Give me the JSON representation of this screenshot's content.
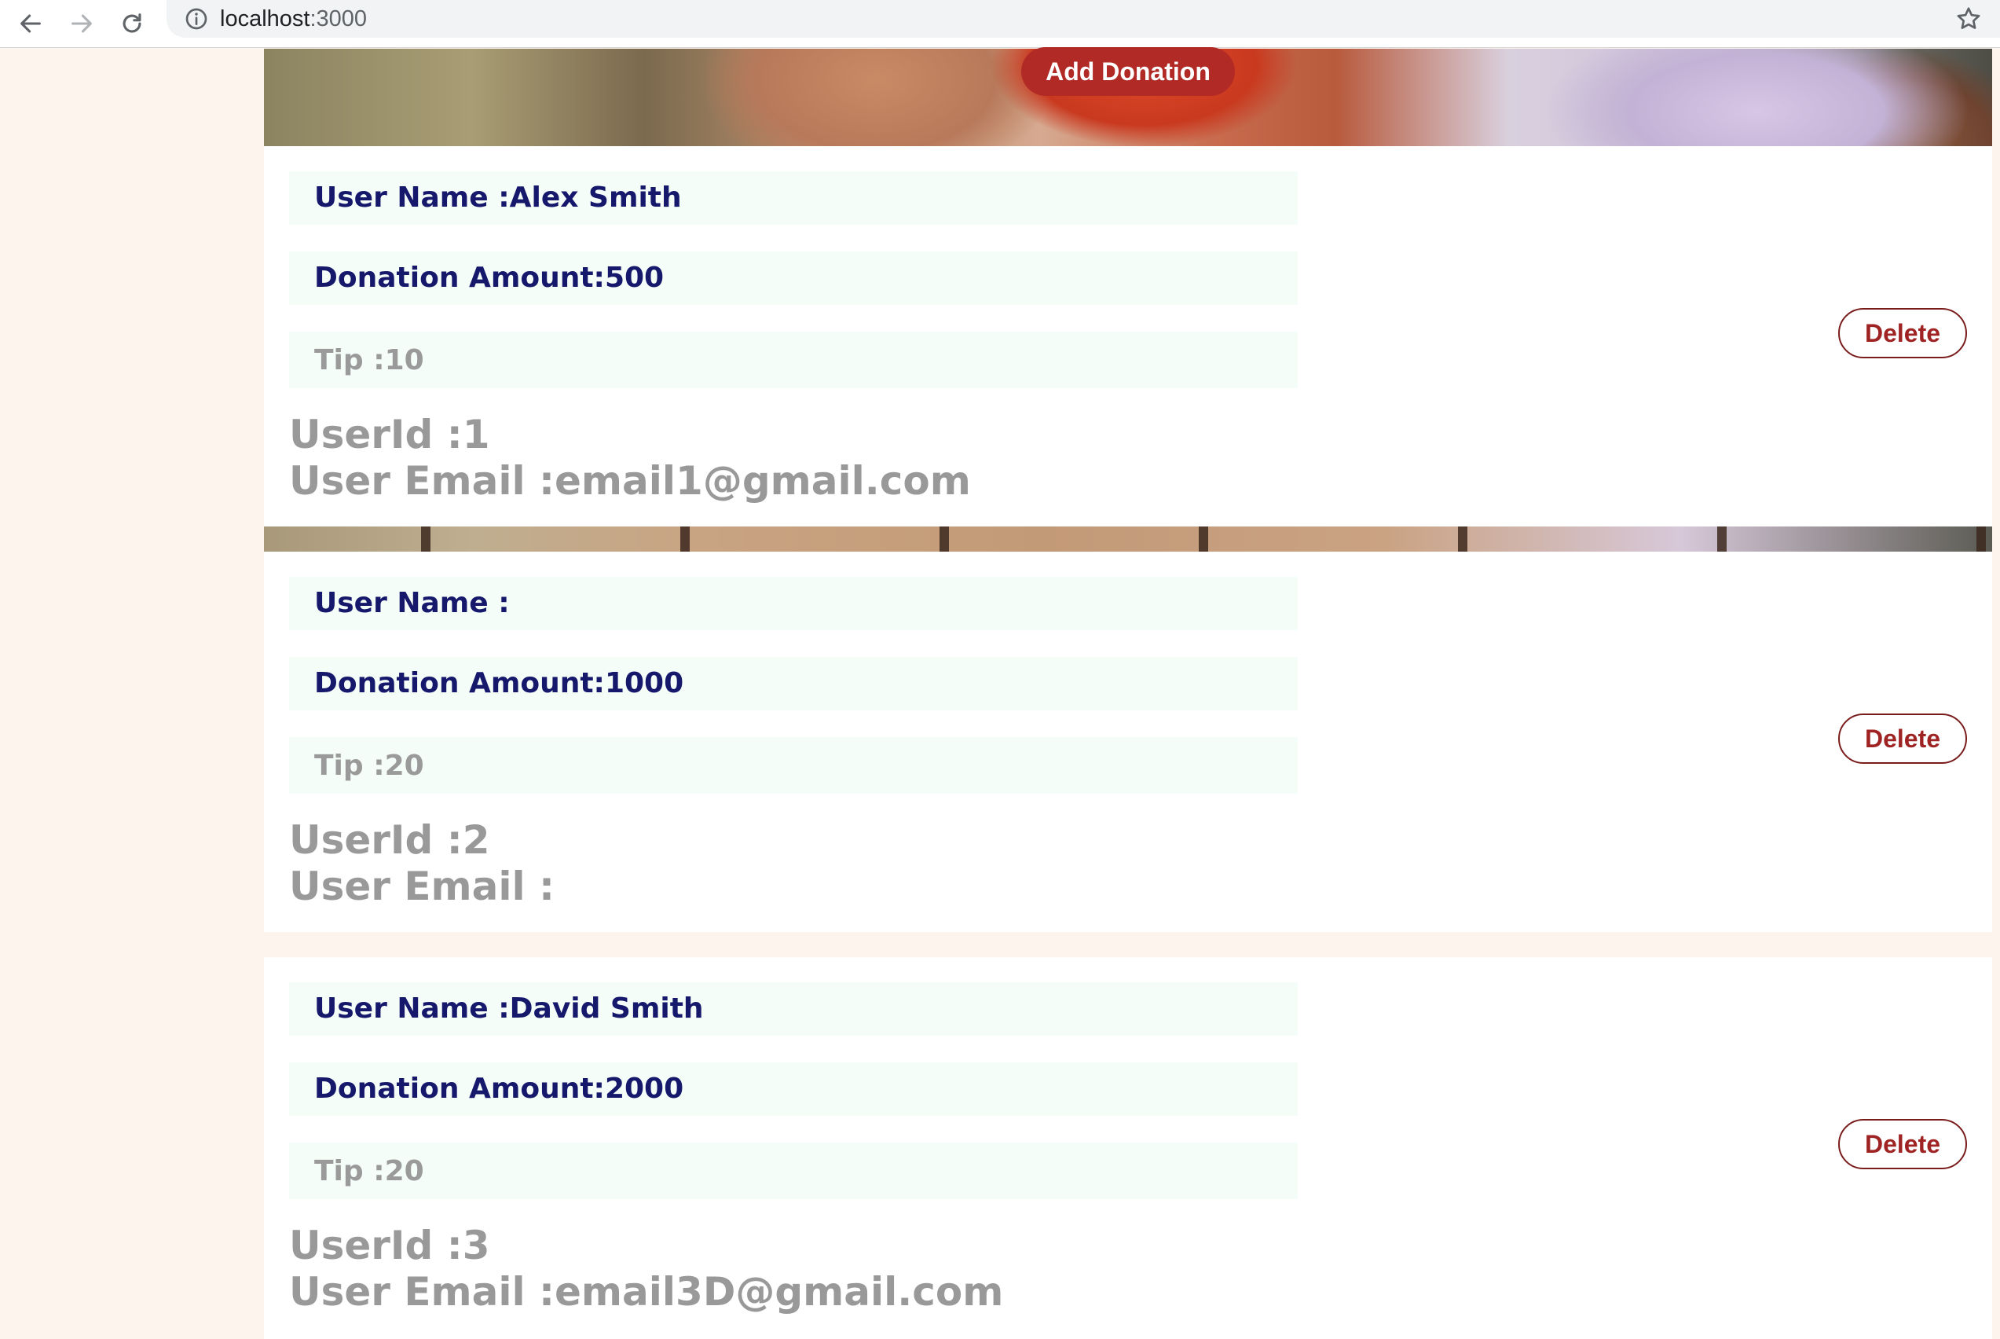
{
  "browser": {
    "url_host": "localhost",
    "url_port": ":3000"
  },
  "header": {
    "add_donation_label": "Add Donation"
  },
  "donations": [
    {
      "user_name": "User Name :Alex Smith",
      "amount": "Donation Amount:500",
      "tip": "Tip :10",
      "user_id": "UserId :1",
      "user_email": "User Email :email1@gmail.com",
      "delete_label": "Delete"
    },
    {
      "user_name": "User Name :",
      "amount": "Donation Amount:1000",
      "tip": "Tip :20",
      "user_id": "UserId :2",
      "user_email": "User Email :",
      "delete_label": "Delete"
    },
    {
      "user_name": "User Name :David Smith",
      "amount": "Donation Amount:2000",
      "tip": "Tip :20",
      "user_id": "UserId :3",
      "user_email": "User Email :email3D@gmail.com",
      "delete_label": "Delete"
    }
  ],
  "icons": {
    "back": "arrow-left",
    "forward": "arrow-right",
    "reload": "reload",
    "info": "info-circle",
    "bookmark": "star-outline"
  },
  "colors": {
    "accent_button": "#b22a25",
    "delete_text": "#9f2323",
    "label_dark": "#15186b",
    "label_gray": "#9a9a9a",
    "field_bg": "#f5fdf9",
    "page_bg": "#fdf4ee"
  }
}
